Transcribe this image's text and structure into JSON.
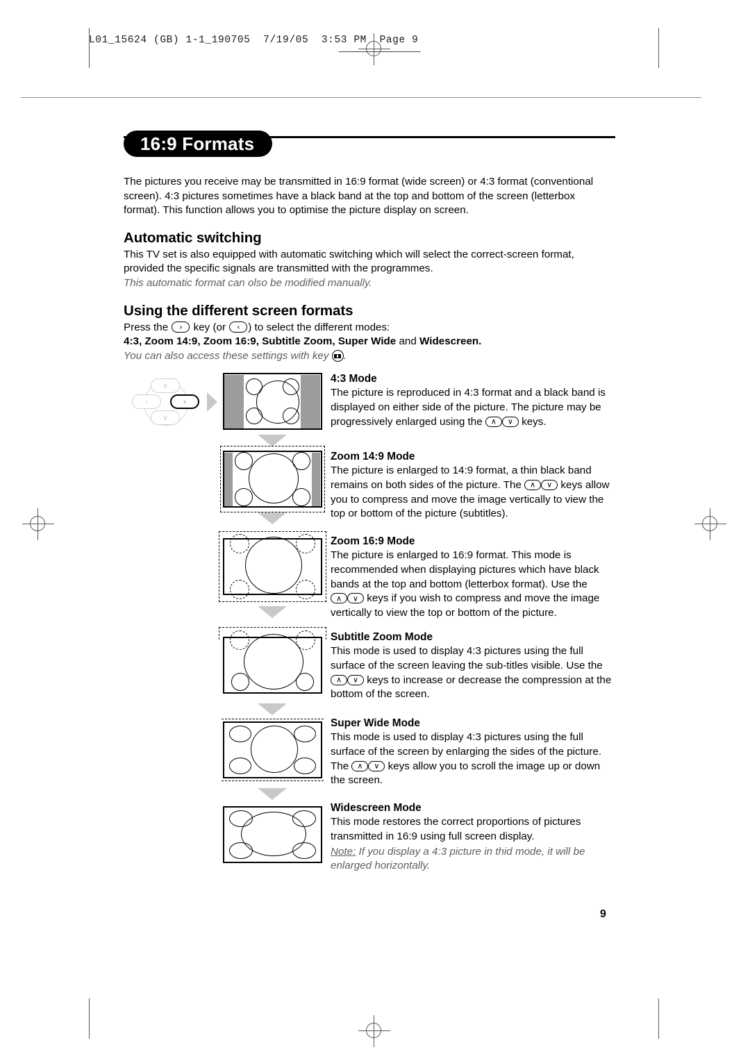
{
  "print_slug": "L01_15624 (GB) 1-1_190705  7/19/05  3:53 PM  Page 9",
  "page_number": "9",
  "title": "16:9 Formats",
  "intro": "The pictures you receive may be transmitted in 16:9 format (wide screen) or 4:3 format (conventional screen). 4:3 pictures sometimes have a black band at the top and bottom of the screen (letterbox format). This function allows you to optimise the picture display on screen.",
  "sections": {
    "automatic": {
      "heading": "Automatic switching",
      "body": "This TV set is also equipped with automatic switching which will select the correct-screen format, provided the specific signals are transmitted with the programmes.",
      "note": "This automatic format can olso be modified manually."
    },
    "using": {
      "heading": "Using the different screen formats",
      "press_prefix": "Press the",
      "press_mid": "key (or",
      "press_suffix": ") to select the different modes:",
      "modes_list": "4:3, Zoom 14:9, Zoom 16:9, Subtitle Zoom, Super Wide",
      "modes_and": " and ",
      "modes_last": "Widescreen.",
      "access_note_prefix": "You can also access these settings with key",
      "access_note_suffix": "."
    }
  },
  "keys": {
    "right": "›",
    "left": "‹",
    "up": "∧",
    "down": "∨",
    "format_key": "format-key"
  },
  "modes": [
    {
      "id": "mode-4-3",
      "title": "4:3 Mode",
      "lines": [
        "The picture is reproduced in 4:3 format and a black band is",
        "displayed on either side of the picture. The picture may be",
        "progressively enlarged using the"
      ],
      "tail": "keys."
    },
    {
      "id": "mode-zoom-14-9",
      "title": "Zoom 14:9 Mode",
      "lines": [
        "The picture is enlarged to 14:9 format, a thin black band",
        "remains on both sides of the picture. The"
      ],
      "tail": "keys allow you to compress and move the image vertically to view the top or bottom of the picture (subtitles)."
    },
    {
      "id": "mode-zoom-16-9",
      "title": "Zoom 16:9 Mode",
      "lines": [
        "The picture is enlarged to 16:9 format. This mode is recommended when displaying pictures which have black bands at the top and bottom (letterbox format).",
        "Use the"
      ],
      "tail": "keys if you wish to compress and move the image vertically to view the top or bottom of the picture."
    },
    {
      "id": "mode-subtitle-zoom",
      "title": "Subtitle Zoom Mode",
      "lines": [
        "This mode is used to display 4:3 pictures using the full surface of the screen leaving the sub-titles visible.",
        "Use the"
      ],
      "tail": "keys to increase or decrease the compression at the bottom of the screen."
    },
    {
      "id": "mode-super-wide",
      "title": "Super Wide Mode",
      "lines": [
        "This mode is used to display 4:3 pictures using the full surface of the screen by enlarging the sides of the picture.",
        "The"
      ],
      "tail": "keys allow you to scroll the image up or down the screen."
    },
    {
      "id": "mode-widescreen",
      "title": "Widescreen Mode",
      "lines": [
        "This mode restores the correct proportions of pictures transmitted in 16:9 using full screen display."
      ],
      "note_label": "Note:",
      "note_text": " If you display a 4:3 picture in thid mode, it will be enlarged horizontally."
    }
  ]
}
